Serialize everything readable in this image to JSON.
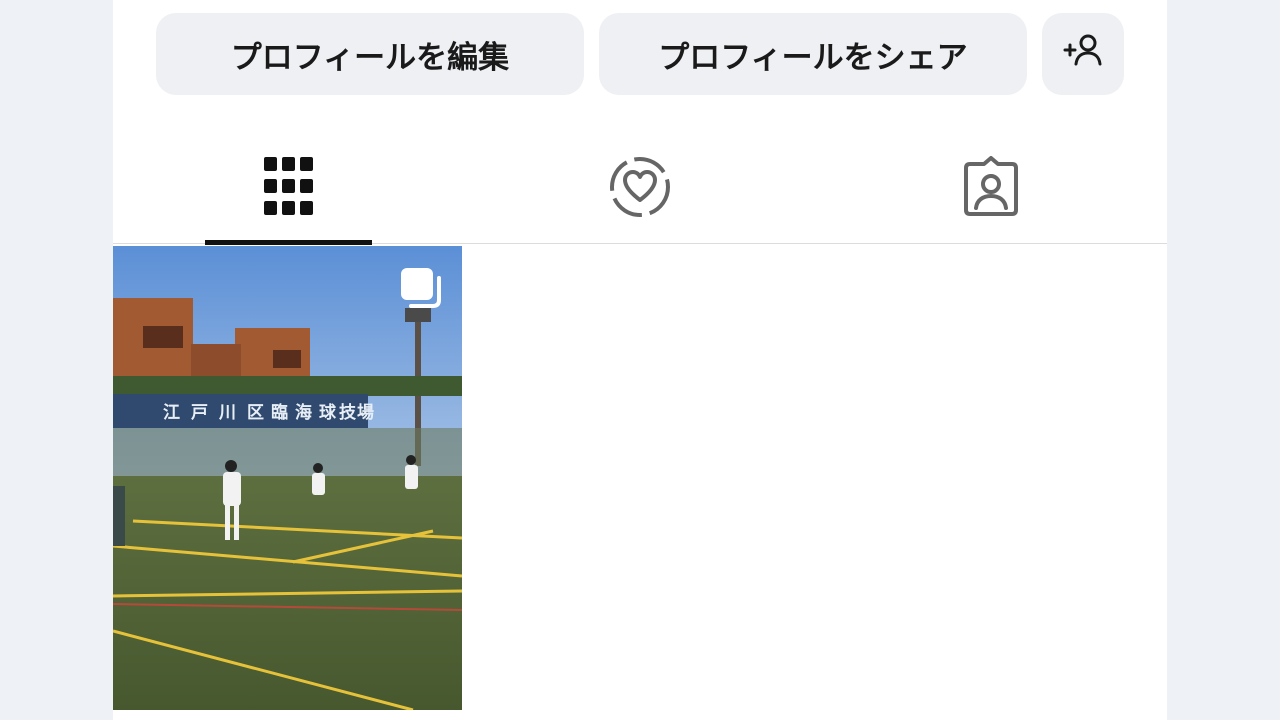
{
  "profile_actions": {
    "edit_label": "プロフィールを編集",
    "share_label": "プロフィールをシェア",
    "add_friend_icon": "add-person-icon"
  },
  "tabs": [
    {
      "name": "posts",
      "icon": "grid-icon",
      "selected": true
    },
    {
      "name": "reposts",
      "icon": "repost-heart-icon",
      "selected": false
    },
    {
      "name": "tagged",
      "icon": "tagged-person-icon",
      "selected": false
    }
  ],
  "posts": [
    {
      "type": "carousel",
      "banner_text": [
        "江",
        "戸",
        "川",
        "区",
        "臨",
        "海",
        "球",
        "技",
        "場"
      ],
      "scene": "lacrosse-field"
    }
  ],
  "colors": {
    "background": "#eef1f5",
    "button_bg": "#eef0f3",
    "text": "#1a1a1a",
    "tab_active": "#111111",
    "tab_inactive": "#666666"
  }
}
